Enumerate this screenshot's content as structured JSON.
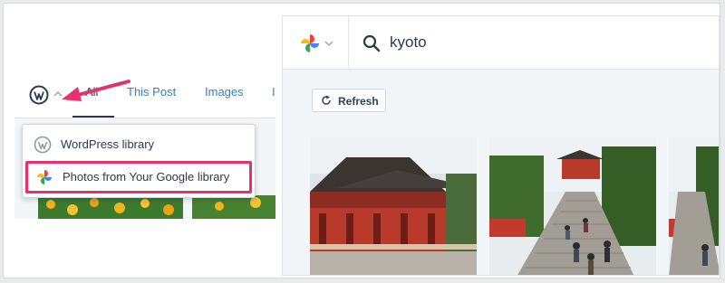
{
  "left_panel": {
    "tabs": [
      "All",
      "This Post",
      "Images",
      "I"
    ],
    "dropdown": {
      "items": [
        {
          "label": "WordPress library",
          "icon": "wordpress-icon"
        },
        {
          "label": "Photos from Your Google library",
          "icon": "google-photos-icon"
        }
      ]
    },
    "highlight_color": "#e8306f"
  },
  "right_panel": {
    "search": {
      "value": "kyoto",
      "icon": "search-icon"
    },
    "refresh_label": "Refresh",
    "photos": [
      {
        "name": "photo-shrine-1"
      },
      {
        "name": "photo-shrine-2"
      },
      {
        "name": "photo-shrine-3"
      }
    ]
  },
  "colors": {
    "accent": "#2e82c4",
    "text": "#2b3a4a",
    "annotation": "#e8306f"
  }
}
